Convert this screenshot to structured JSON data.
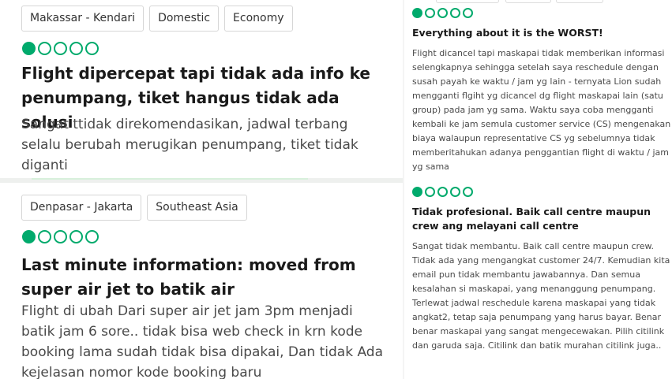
{
  "review1": {
    "tags": [
      "Makassar - Kendari",
      "Domestic",
      "Economy"
    ],
    "rating": 1,
    "title": "Flight dipercepat tapi tidak ada info ke penumpang, tiket hangus tidak ada solusi",
    "body": "Sangat ttidak direkomendasikan, jadwal terbang selalu berubah merugikan penumpang, tiket tidak diganti"
  },
  "review2": {
    "tags": [
      "Denpasar - Jakarta",
      "Southeast Asia"
    ],
    "rating": 1,
    "title": "Last minute information: moved from super air jet to batik air",
    "body": "Flight di ubah Dari super air jet jam 3pm menjadi batik jam 6 sore.. tidak bisa web check in krn kode booking lama sudah tidak bisa dipakai, Dan tidak Ada kejelasan nomor kode booking baru"
  },
  "review3": {
    "rating": 1,
    "title": "Everything about it is the WORST!",
    "body": "Flight dicancel tapi maskapai tidak memberikan informasi selengkapnya sehingga setelah saya reschedule dengan susah payah ke waktu / jam yg lain - ternyata Lion sudah mengganti flgiht yg dicancel dg flight maskapai lain (satu group) pada jam yg sama. Waktu saya coba mengganti kembali ke jam semula customer service (CS) mengenakan biaya walaupun representative CS yg sebelumnya tidak memberitahukan adanya penggantian flight di waktu / jam yg sama"
  },
  "review4": {
    "rating": 1,
    "title": "Tidak profesional. Baik call centre maupun crew ang melayani call centre",
    "body": "Sangat tidak membantu. Baik call centre maupun crew. Tidak ada yang mengangkat customer 24/7. Kemudian kita email pun tidak membantu jawabannya. Dan semua kesalahan si maskapai, yang menanggung penumpang. Terlewat jadwal reschedule karena maskapai yang tidak angkat2, tetap saja penumpang yang harus bayar. Benar benar maskapai yang sangat mengecewakan. Pilih citilink dan garuda saja. Citilink dan batik murahan citilink juga.."
  },
  "colors": {
    "bubble": "#00aa6c",
    "tag_border": "#d6d6d6"
  }
}
